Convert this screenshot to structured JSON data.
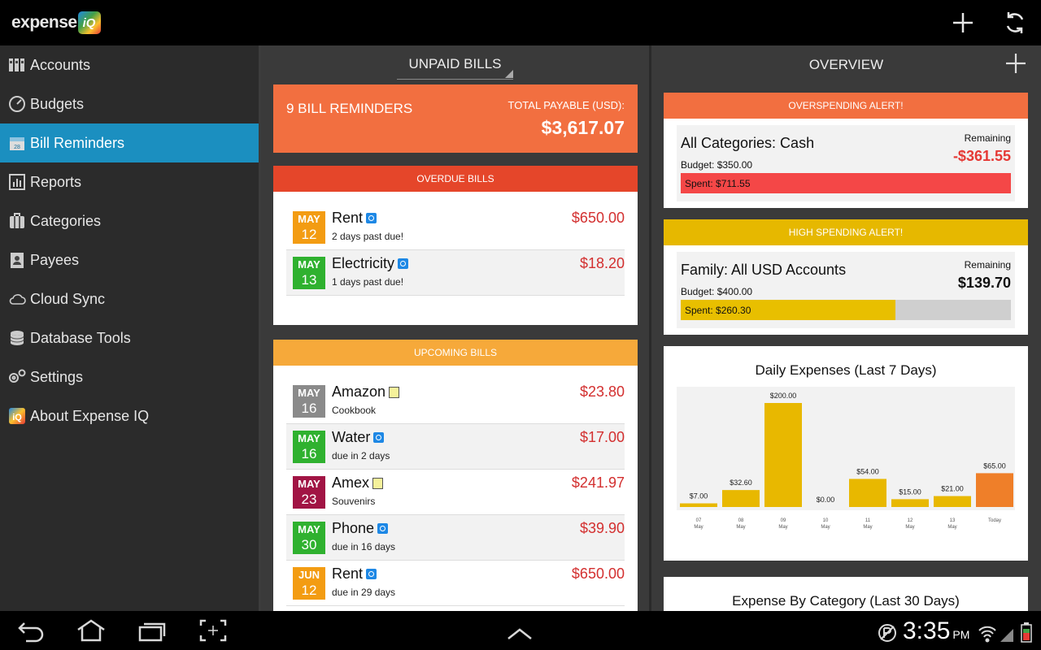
{
  "app": {
    "logo_text": "expense",
    "logo_badge": "iQ"
  },
  "sidebar": {
    "items": [
      {
        "label": "Accounts",
        "icon": "accounts-icon",
        "active": false
      },
      {
        "label": "Budgets",
        "icon": "budgets-icon",
        "active": false
      },
      {
        "label": "Bill Reminders",
        "icon": "calendar-icon",
        "active": true
      },
      {
        "label": "Reports",
        "icon": "reports-icon",
        "active": false
      },
      {
        "label": "Categories",
        "icon": "categories-icon",
        "active": false
      },
      {
        "label": "Payees",
        "icon": "payees-icon",
        "active": false
      },
      {
        "label": "Cloud Sync",
        "icon": "cloud-icon",
        "active": false
      },
      {
        "label": "Database Tools",
        "icon": "database-icon",
        "active": false
      },
      {
        "label": "Settings",
        "icon": "settings-icon",
        "active": false
      },
      {
        "label": "About Expense IQ",
        "icon": "about-icon",
        "active": false
      }
    ]
  },
  "bills": {
    "selector": "UNPAID BILLS",
    "summary": {
      "count": "9 BILL REMINDERS",
      "total_label": "TOTAL PAYABLE (USD):",
      "total_value": "$3,617.07"
    },
    "overdue": {
      "header": "OVERDUE BILLS",
      "items": [
        {
          "month": "MAY",
          "day": "12",
          "name": "Rent",
          "sub": "2 days past due!",
          "amount": "$650.00",
          "tag": "recur"
        },
        {
          "month": "MAY",
          "day": "13",
          "name": "Electricity",
          "sub": "1 days past due!",
          "amount": "$18.20",
          "tag": "recur"
        }
      ]
    },
    "upcoming": {
      "header": "UPCOMING BILLS",
      "items": [
        {
          "month": "MAY",
          "day": "16",
          "name": "Amazon",
          "sub": "Cookbook",
          "amount": "$23.80",
          "tag": "note"
        },
        {
          "month": "MAY",
          "day": "16",
          "name": "Water",
          "sub": "due in 2 days",
          "amount": "$17.00",
          "tag": "recur"
        },
        {
          "month": "MAY",
          "day": "23",
          "name": "Amex",
          "sub": "Souvenirs",
          "amount": "$241.97",
          "tag": "note"
        },
        {
          "month": "MAY",
          "day": "30",
          "name": "Phone",
          "sub": "due in 16 days",
          "amount": "$39.90",
          "tag": "recur"
        },
        {
          "month": "JUN",
          "day": "12",
          "name": "Rent",
          "sub": "due in 29 days",
          "amount": "$650.00",
          "tag": "recur"
        }
      ]
    }
  },
  "overview": {
    "title": "OVERVIEW",
    "alerts": [
      {
        "header": "OVERSPENDING ALERT!",
        "title": "All Categories: Cash",
        "remaining_label": "Remaining",
        "remaining_value": "-$361.55",
        "budget": "Budget: $350.00",
        "spent": "Spent: $711.55",
        "fraction": 1.0
      },
      {
        "header": "HIGH SPENDING ALERT!",
        "title": "Family: All USD Accounts",
        "remaining_label": "Remaining",
        "remaining_value": "$139.70",
        "budget": "Budget: $400.00",
        "spent": "Spent: $260.30",
        "fraction": 0.6508
      }
    ],
    "expense_by_category_title": "Expense By Category (Last 30 Days)"
  },
  "chart_data": {
    "type": "bar",
    "title": "Daily Expenses (Last 7 Days)",
    "categories": [
      "07 May",
      "08 May",
      "09 May",
      "10 May",
      "11 May",
      "12 May",
      "13 May",
      "Today"
    ],
    "tick_top": [
      "07",
      "08",
      "09",
      "10",
      "11",
      "12",
      "13",
      "Today"
    ],
    "tick_bottom": [
      "May",
      "May",
      "May",
      "May",
      "May",
      "May",
      "May",
      ""
    ],
    "values": [
      7.0,
      32.6,
      200.0,
      0.0,
      54.0,
      15.0,
      21.0,
      65.0
    ],
    "value_labels": [
      "$7.00",
      "$32.60",
      "$200.00",
      "$0.00",
      "$54.00",
      "$15.00",
      "$21.00",
      "$65.00"
    ],
    "ylim": [
      0,
      200
    ],
    "colors": {
      "default": "#e8b800",
      "today": "#ef7f29"
    }
  },
  "colors": {
    "accent": "#1b8fc0",
    "overdue_header": "#e5462a",
    "upcoming_header": "#f6a93a",
    "summary": "#f26f40",
    "overspend_header": "#f26f40",
    "highspend_header": "#e6b800",
    "overspend_bar": "#f44747",
    "highspend_bar": "#e8bf00",
    "danger": "#d32f2f"
  },
  "status": {
    "time": "3:35",
    "ampm": "PM"
  }
}
